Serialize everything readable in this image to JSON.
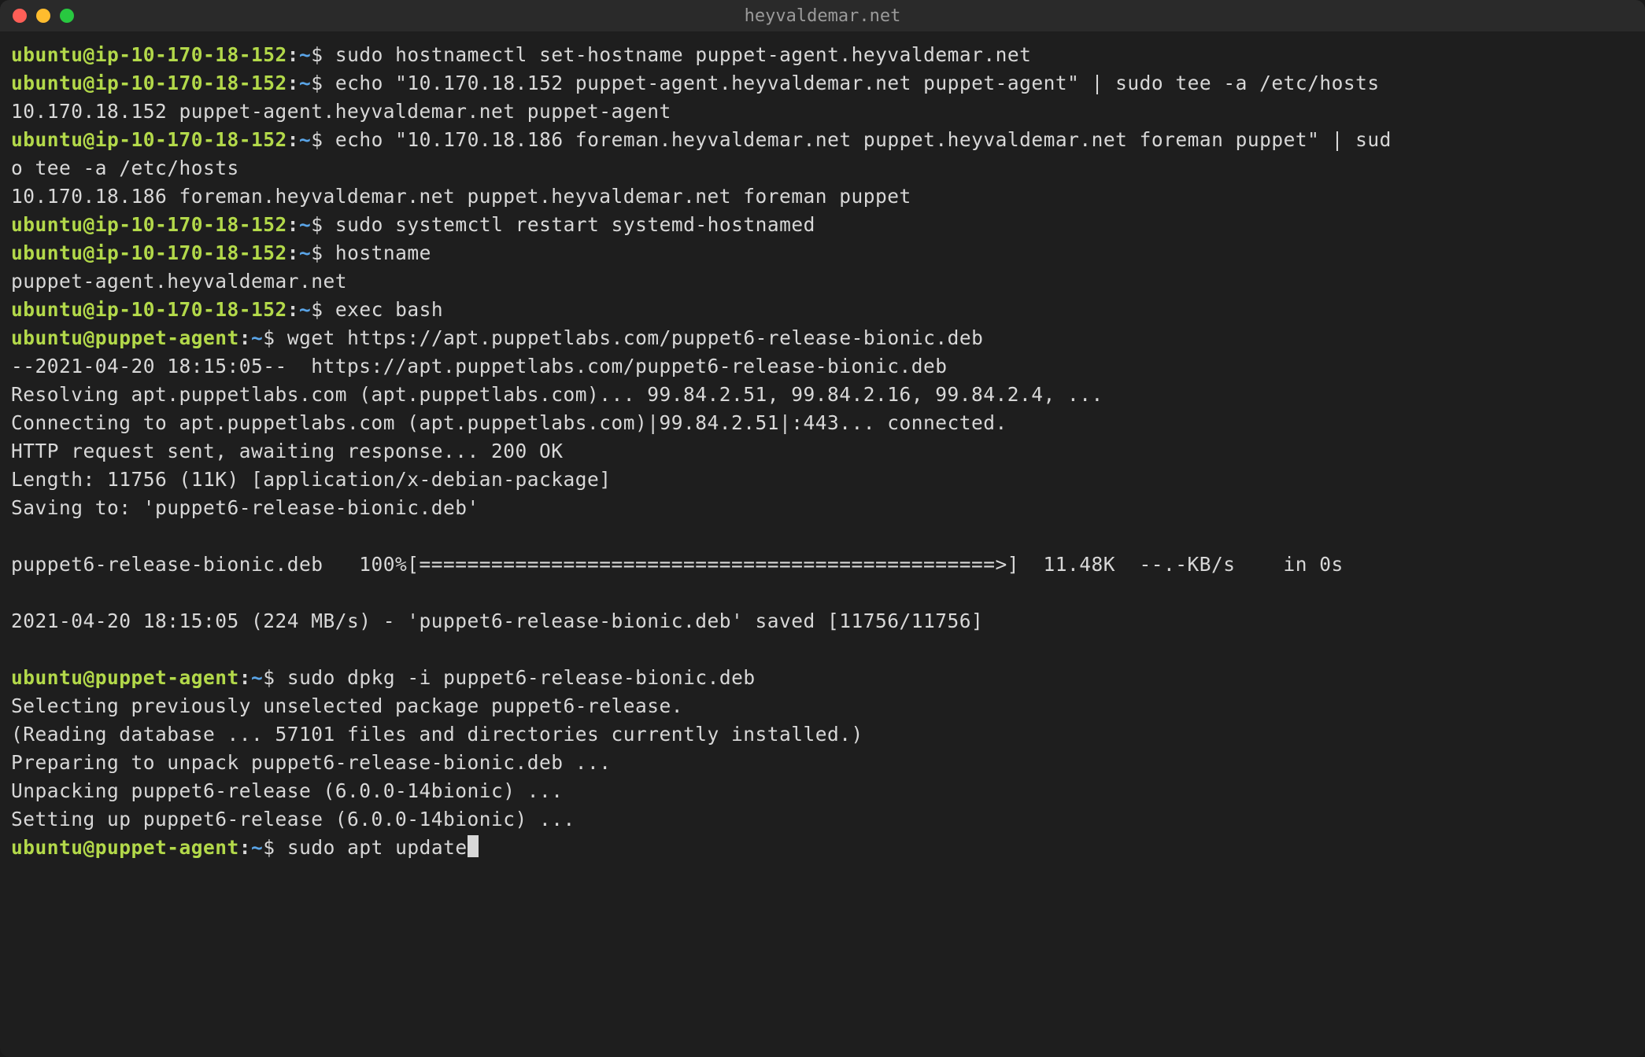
{
  "window": {
    "title": "heyvaldemar.net"
  },
  "prompts": {
    "ip": {
      "userhost": "ubuntu@ip-10-170-18-152",
      "path": "~",
      "symbol": "$"
    },
    "agent": {
      "userhost": "ubuntu@puppet-agent",
      "path": "~",
      "symbol": "$"
    }
  },
  "lines": {
    "cmd1": " sudo hostnamectl set-hostname puppet-agent.heyvaldemar.net",
    "cmd2": " echo \"10.170.18.152 puppet-agent.heyvaldemar.net puppet-agent\" | sudo tee -a /etc/hosts",
    "out2": "10.170.18.152 puppet-agent.heyvaldemar.net puppet-agent",
    "cmd3a": " echo \"10.170.18.186 foreman.heyvaldemar.net puppet.heyvaldemar.net foreman puppet\" | sud",
    "cmd3b": "o tee -a /etc/hosts",
    "out3": "10.170.18.186 foreman.heyvaldemar.net puppet.heyvaldemar.net foreman puppet",
    "cmd4": " sudo systemctl restart systemd-hostnamed",
    "cmd5": " hostname",
    "out5": "puppet-agent.heyvaldemar.net",
    "cmd6": " exec bash",
    "cmd7": " wget https://apt.puppetlabs.com/puppet6-release-bionic.deb",
    "out7a": "--2021-04-20 18:15:05--  https://apt.puppetlabs.com/puppet6-release-bionic.deb",
    "out7b": "Resolving apt.puppetlabs.com (apt.puppetlabs.com)... 99.84.2.51, 99.84.2.16, 99.84.2.4, ...",
    "out7c": "Connecting to apt.puppetlabs.com (apt.puppetlabs.com)|99.84.2.51|:443... connected.",
    "out7d": "HTTP request sent, awaiting response... 200 OK",
    "out7e": "Length: 11756 (11K) [application/x-debian-package]",
    "out7f": "Saving to: 'puppet6-release-bionic.deb'",
    "out7g": "puppet6-release-bionic.deb   100%[================================================>]  11.48K  --.-KB/s    in 0s",
    "out7h": "2021-04-20 18:15:05 (224 MB/s) - 'puppet6-release-bionic.deb' saved [11756/11756]",
    "cmd8": " sudo dpkg -i puppet6-release-bionic.deb",
    "out8a": "Selecting previously unselected package puppet6-release.",
    "out8b": "(Reading database ... 57101 files and directories currently installed.)",
    "out8c": "Preparing to unpack puppet6-release-bionic.deb ...",
    "out8d": "Unpacking puppet6-release (6.0.0-14bionic) ...",
    "out8e": "Setting up puppet6-release (6.0.0-14bionic) ...",
    "cmd9": " sudo apt update"
  }
}
